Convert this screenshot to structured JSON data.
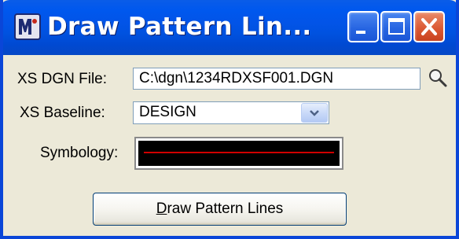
{
  "window": {
    "title": "Draw Pattern Lin...",
    "app_icon": "microstation-icon",
    "controls": {
      "minimize": "minimize-icon",
      "maximize": "maximize-icon",
      "close": "close-icon"
    }
  },
  "form": {
    "xs_dgn_file": {
      "label": "XS DGN File:",
      "value": "C:\\dgn\\1234RDXSF001.DGN",
      "browse_icon": "magnifier-icon"
    },
    "xs_baseline": {
      "label": "XS Baseline:",
      "value": "DESIGN"
    },
    "symbology": {
      "label": "Symbology:",
      "background_color": "#000000",
      "line_color": "#d00000"
    },
    "action": {
      "label_mnemonic": "D",
      "label_rest": "raw Pattern Lines"
    }
  },
  "colors": {
    "titlebar": "#0052e0",
    "window_face": "#ece9d8",
    "close_button": "#dc5a34"
  }
}
